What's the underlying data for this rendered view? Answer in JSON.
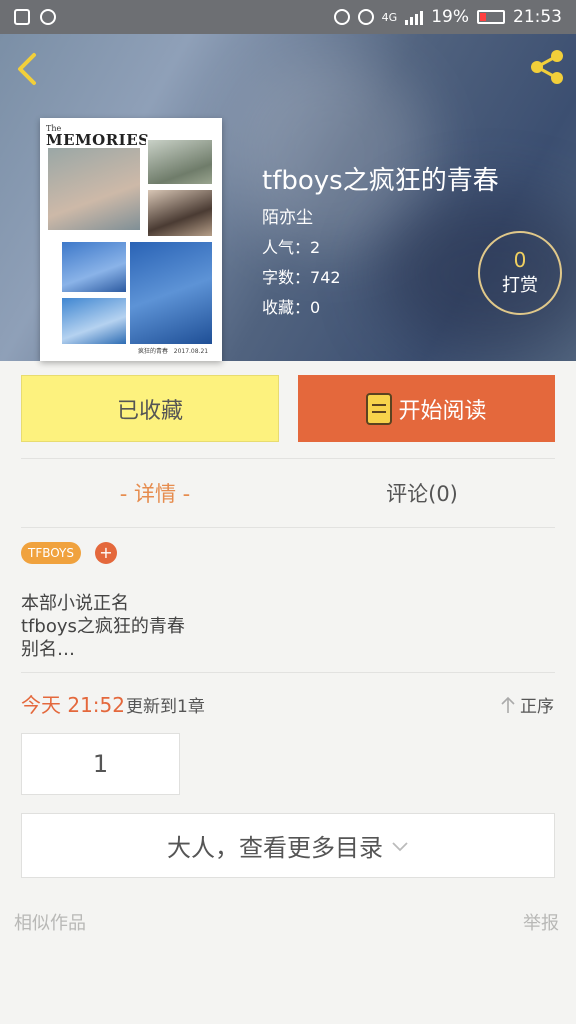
{
  "status_bar": {
    "network": "4G",
    "battery": "19%",
    "time": "21:53"
  },
  "book": {
    "title": "tfboys之疯狂的青春",
    "author": "陌亦尘",
    "popularity_label": "人气：",
    "popularity": "2",
    "words_label": "字数：",
    "words": "742",
    "favorites_label": "收藏：",
    "favorites": "0",
    "tip_count": "0",
    "tip_label": "打赏"
  },
  "cover": {
    "title_small": "The",
    "title_big": "MEMORIES",
    "caption_name": "疯狂的青春",
    "caption_date": "2017.08.21"
  },
  "actions": {
    "favorited_label": "已收藏",
    "read_label": "开始阅读"
  },
  "tabs": {
    "detail": "- 详情 -",
    "comments": "评论(0)"
  },
  "tags": [
    "TFBOYS"
  ],
  "tag_add": "+",
  "description": [
    "本部小说正名",
    "tfboys之疯狂的青春",
    "别名…"
  ],
  "update": {
    "time": "今天 21:52",
    "text": "更新到1章",
    "sort_label": "正序"
  },
  "chapters": [
    "1"
  ],
  "more_catalog": "大人，查看更多目录",
  "footer": {
    "similar": "相似作品",
    "report": "举报"
  },
  "colors": {
    "accent_orange": "#e4683c",
    "favorite_yellow": "#fdf27e",
    "tab_active": "#e68c4e"
  }
}
